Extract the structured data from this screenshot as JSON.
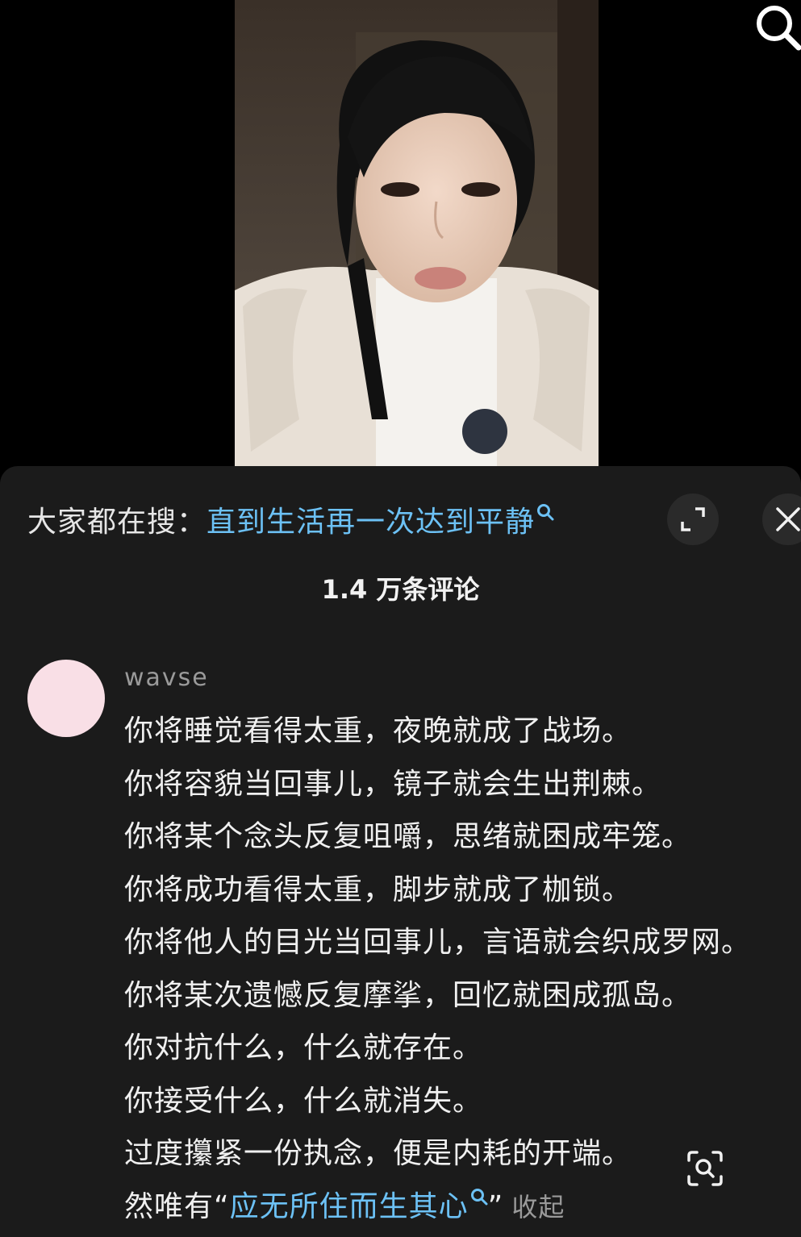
{
  "video": {
    "search_icon": "search-icon"
  },
  "hot_search": {
    "label": "大家都在搜：",
    "query": "直到生活再一次达到平静",
    "search_icon": "mini-search-icon"
  },
  "controls": {
    "expand_icon": "expand-icon",
    "close_icon": "close-icon"
  },
  "comments": {
    "count_label": "1.4 万条评论"
  },
  "comment": {
    "username": "wavse",
    "avatar_color": "#f9dfe6",
    "lines": [
      "你将睡觉看得太重，夜晚就成了战场。",
      "你将容貌当回事儿，镜子就会生出荆棘。",
      "你将某个念头反复咀嚼，思绪就困成牢笼。",
      "你将成功看得太重，脚步就成了枷锁。",
      "你将他人的目光当回事儿，言语就会织成罗网。",
      "你将某次遗憾反复摩挲，回忆就困成孤岛。",
      "你对抗什么，什么就存在。",
      "你接受什么，什么就消失。",
      "过度攥紧一份执念，便是内耗的开端。"
    ],
    "last_line_prefix": "然唯有“",
    "last_line_keyword": "应无所住而生其心",
    "last_line_suffix": "”",
    "collapse_label": "收起"
  },
  "colors": {
    "link": "#6cc1f5",
    "sheet_bg": "#1b1b1b",
    "text": "#f0f0f0",
    "muted": "#9a9a9a"
  },
  "scan_icon": "scan-search-icon"
}
